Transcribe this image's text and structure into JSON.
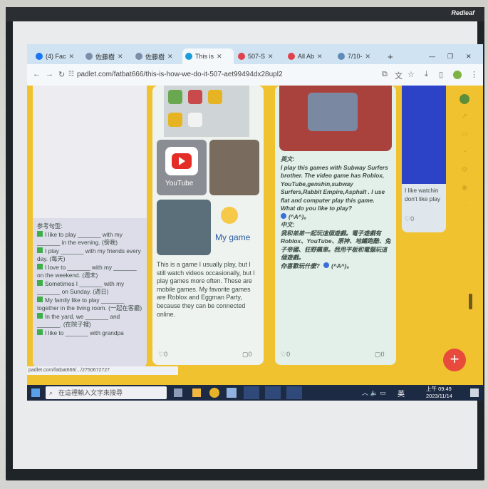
{
  "projector": {
    "brand": "Redleaf"
  },
  "browser": {
    "tabs": [
      {
        "label": "(4) Fac"
      },
      {
        "label": "佐藤樹"
      },
      {
        "label": "佐藤樹"
      },
      {
        "label": "This is"
      },
      {
        "label": "507-S"
      },
      {
        "label": "All Ab"
      },
      {
        "label": "7/10-"
      }
    ],
    "url": "padlet.com/fatbat666/this-is-how-we-do-it-507-aet99494dx28upl2"
  },
  "padlet": {
    "left_card": {
      "heading": "参考句型:",
      "lines": [
        "I like to play _______ with my _______ in the evening. (傍晚)",
        "I play _______ with my friends every day. (每天)",
        "I love to _______ with my _______ on the weekend. (週末)",
        "Sometimes I _______ with my _______ on Sunday. (週日)",
        "My family like to play _______ together in the living room. (一起在客廳)",
        "In the yard, we _______ and _______. (在院子裡)",
        "I like to _______ with grandpa"
      ]
    },
    "middle_card": {
      "youtube_label": "YouTube",
      "mygame_label": "My game",
      "text": "This is a game I usually play, but I still watch videos occasionally, but I play games more often. These are mobile games. My favorite games are Roblox and Eggman Party, because they can be connected online.",
      "likes": "0",
      "comments": "0"
    },
    "right_card": {
      "en_heading": "英文:",
      "en_text": "I play this games with Subway Surfers brother. The video game has Roblox, YouTube,genshin,subway Surfers,Rabbit Empire,Asphalt . I use flat and computer play this game.",
      "en_question": "What do you like to play?",
      "en_emote": "(^A^)。",
      "zh_heading": "中文:",
      "zh_text": "我和弟弟一起玩這個遊戲。電子遊戲有Roblox、YouTube、原神、地鐵跑酷、兔子帝國、狂野飆車。我用平板和電腦玩這個遊戲。",
      "zh_question": "你喜歡玩什麼?",
      "zh_emote": "(^A^)。",
      "likes": "0",
      "comments": "0"
    },
    "far_right_card": {
      "text": "I like watchin don't like play",
      "likes": "0"
    },
    "status_url": "padlet.com/fatbat666/.../2750672727"
  },
  "taskbar": {
    "search_placeholder": "在這裡輸入文字來搜尋",
    "ime": "英",
    "time": "上午 09:49",
    "date": "2023/11/14"
  },
  "colors": {
    "padlet_bg": "#f1c230",
    "fab": "#e84b3c",
    "taskbar": "#1d2a44"
  }
}
